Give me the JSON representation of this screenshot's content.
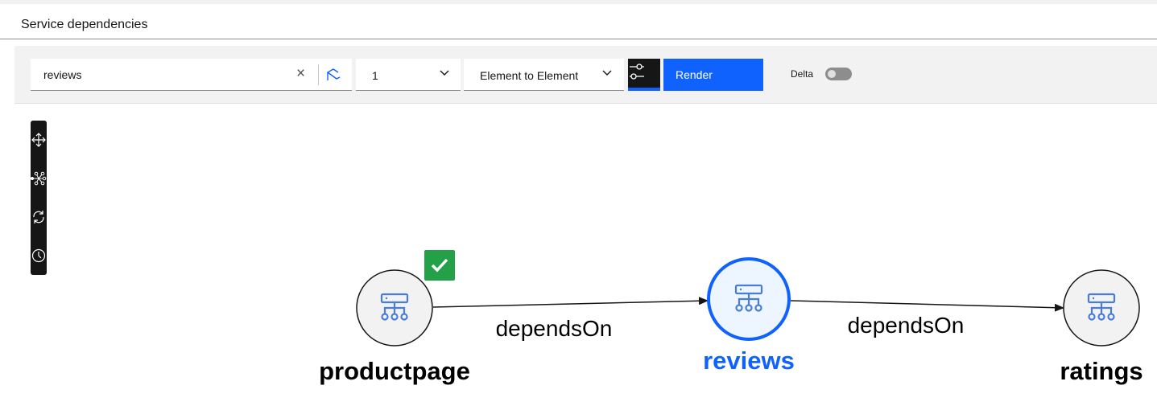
{
  "header": {
    "title": "Service dependencies"
  },
  "toolbar": {
    "search_value": "reviews",
    "clear_icon": "×",
    "depth_value": "1",
    "relationship_value": "Element to Element",
    "render_label": "Render",
    "delta_label": "Delta",
    "delta_on": false,
    "accent": "#0f62fe"
  },
  "side_tools": [
    "move-icon",
    "topology-icon",
    "refresh-icon",
    "history-icon"
  ],
  "graph": {
    "nodes": [
      {
        "label": "productpage",
        "status": "ok",
        "selected": false
      },
      {
        "label": "reviews",
        "selected": true
      },
      {
        "label": "ratings",
        "selected": false
      }
    ],
    "edges": [
      {
        "from": "productpage",
        "to": "reviews",
        "label": "dependsOn"
      },
      {
        "from": "reviews",
        "to": "ratings",
        "label": "dependsOn"
      }
    ]
  }
}
